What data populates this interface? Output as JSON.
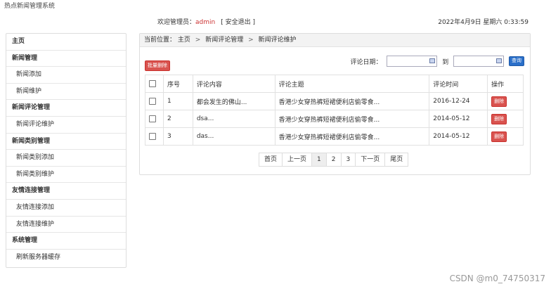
{
  "app": {
    "title": "热点新闻管理系统"
  },
  "topbar": {
    "welcome_label": "欢迎管理员：",
    "username": "admin",
    "logout": "[ 安全退出 ]",
    "datetime": "2022年4月9日 星期六 0:33:59"
  },
  "sidebar": {
    "items": [
      {
        "label": "主页",
        "type": "head"
      },
      {
        "label": "新闻管理",
        "type": "head"
      },
      {
        "label": "新闻添加",
        "type": "sub"
      },
      {
        "label": "新闻维护",
        "type": "sub"
      },
      {
        "label": "新闻评论管理",
        "type": "head"
      },
      {
        "label": "新闻评论维护",
        "type": "sub"
      },
      {
        "label": "新闻类别管理",
        "type": "head"
      },
      {
        "label": "新闻类别添加",
        "type": "sub"
      },
      {
        "label": "新闻类别维护",
        "type": "sub"
      },
      {
        "label": "友情连接管理",
        "type": "head"
      },
      {
        "label": "友情连接添加",
        "type": "sub"
      },
      {
        "label": "友情连接维护",
        "type": "sub"
      },
      {
        "label": "系统管理",
        "type": "head"
      },
      {
        "label": "刷新服务器缓存",
        "type": "sub"
      }
    ]
  },
  "breadcrumb": {
    "prefix": "当前位置：",
    "items": [
      "主页",
      "新闻评论管理",
      "新闻评论维护"
    ],
    "separator": ">"
  },
  "toolbar": {
    "batch_delete": "批量删除",
    "date_label": "评论日期：",
    "to_label": "到",
    "date_from": "",
    "date_to": "",
    "search": "查询"
  },
  "table": {
    "headers": [
      "序号",
      "评论内容",
      "评论主题",
      "评论时间",
      "操作"
    ],
    "rows": [
      {
        "no": "1",
        "content": "都会发生的佛山...",
        "topic": "香港少女穿热裤短裙便利店偷零食...",
        "time": "2016-12-24",
        "action": "删除"
      },
      {
        "no": "2",
        "content": "dsa...",
        "topic": "香港少女穿热裤短裙便利店偷零食...",
        "time": "2014-05-12",
        "action": "删除"
      },
      {
        "no": "3",
        "content": "das...",
        "topic": "香港少女穿热裤短裙便利店偷零食...",
        "time": "2014-05-12",
        "action": "删除"
      }
    ]
  },
  "pager": {
    "first": "首页",
    "prev": "上一页",
    "pages": [
      "1",
      "2",
      "3"
    ],
    "active_page": "1",
    "next": "下一页",
    "last": "尾页"
  },
  "watermark": "CSDN @m0_74750317",
  "colors": {
    "danger": "#d9534f",
    "primary": "#2a6fc9",
    "username": "#cc3333"
  }
}
